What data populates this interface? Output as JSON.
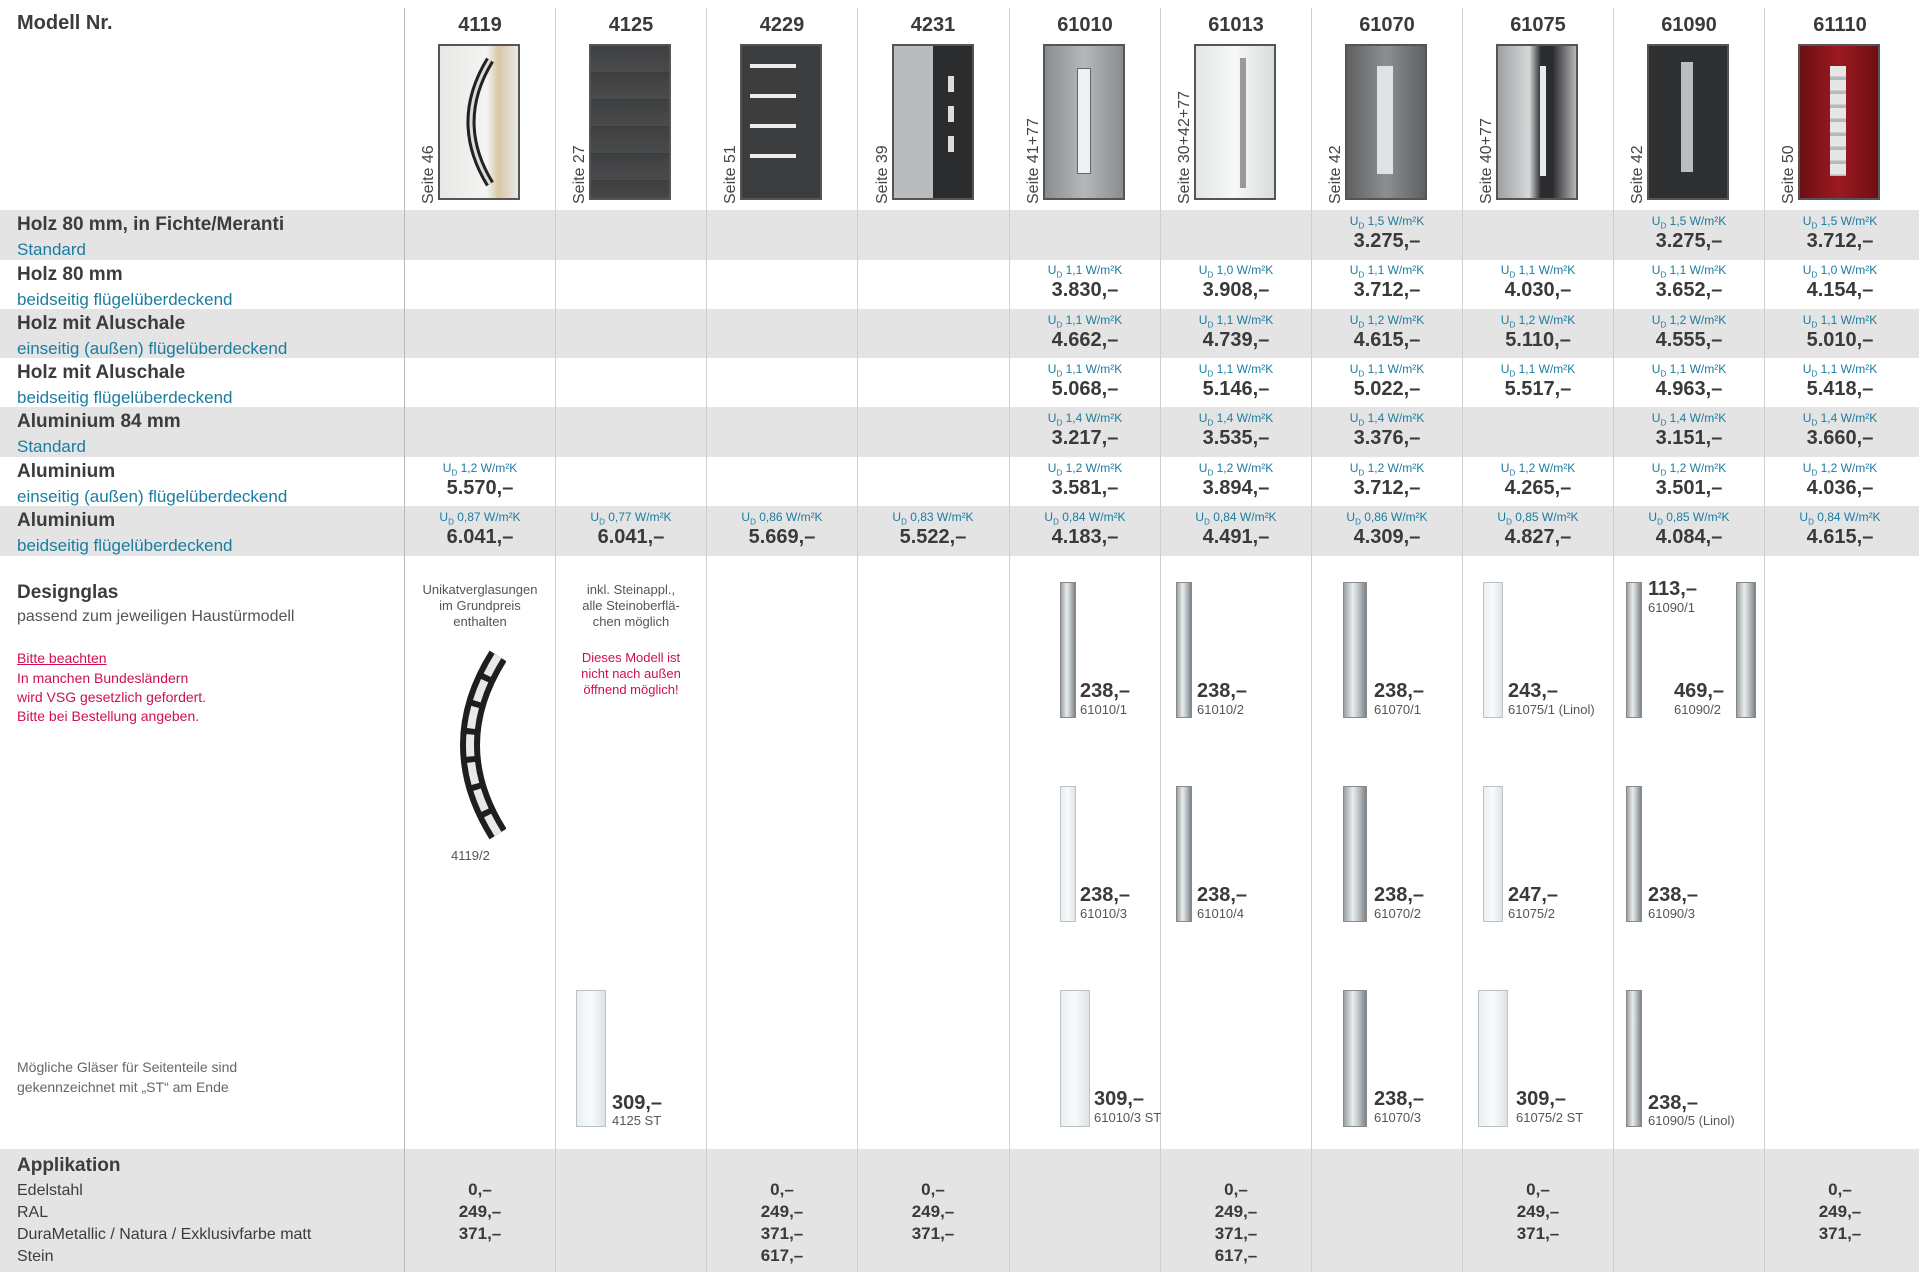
{
  "header": {
    "label": "Modell Nr."
  },
  "models": [
    {
      "nr": "4119",
      "seite": "Seite 46"
    },
    {
      "nr": "4125",
      "seite": "Seite 27"
    },
    {
      "nr": "4229",
      "seite": "Seite 51"
    },
    {
      "nr": "4231",
      "seite": "Seite 39"
    },
    {
      "nr": "61010",
      "seite": "Seite 41+77"
    },
    {
      "nr": "61013",
      "seite": "Seite 30+42+77"
    },
    {
      "nr": "61070",
      "seite": "Seite 42"
    },
    {
      "nr": "61075",
      "seite": "Seite 40+77"
    },
    {
      "nr": "61090",
      "seite": "Seite 42"
    },
    {
      "nr": "61110",
      "seite": "Seite 50"
    }
  ],
  "price_rows": [
    {
      "title": "Holz 80 mm, in Fichte/Meranti",
      "sub": "Standard",
      "cells": [
        null,
        null,
        null,
        null,
        null,
        null,
        {
          "ud": "1,5 W/m²K",
          "price": "3.275,–"
        },
        null,
        {
          "ud": "1,5 W/m²K",
          "price": "3.275,–"
        },
        {
          "ud": "1,5 W/m²K",
          "price": "3.712,–"
        }
      ]
    },
    {
      "title": "Holz 80 mm",
      "sub": "beidseitig flügelüberdeckend",
      "cells": [
        null,
        null,
        null,
        null,
        {
          "ud": "1,1 W/m²K",
          "price": "3.830,–"
        },
        {
          "ud": "1,0 W/m²K",
          "price": "3.908,–"
        },
        {
          "ud": "1,1 W/m²K",
          "price": "3.712,–"
        },
        {
          "ud": "1,1 W/m²K",
          "price": "4.030,–"
        },
        {
          "ud": "1,1 W/m²K",
          "price": "3.652,–"
        },
        {
          "ud": "1,0 W/m²K",
          "price": "4.154,–"
        }
      ]
    },
    {
      "title": "Holz mit Aluschale",
      "sub": "einseitig (außen) flügelüberdeckend",
      "cells": [
        null,
        null,
        null,
        null,
        {
          "ud": "1,1 W/m²K",
          "price": "4.662,–"
        },
        {
          "ud": "1,1 W/m²K",
          "price": "4.739,–"
        },
        {
          "ud": "1,2 W/m²K",
          "price": "4.615,–"
        },
        {
          "ud": "1,2 W/m²K",
          "price": "5.110,–"
        },
        {
          "ud": "1,2 W/m²K",
          "price": "4.555,–"
        },
        {
          "ud": "1,1 W/m²K",
          "price": "5.010,–"
        }
      ]
    },
    {
      "title": "Holz mit Aluschale",
      "sub": "beidseitig flügelüberdeckend",
      "cells": [
        null,
        null,
        null,
        null,
        {
          "ud": "1,1 W/m²K",
          "price": "5.068,–"
        },
        {
          "ud": "1,1 W/m²K",
          "price": "5.146,–"
        },
        {
          "ud": "1,1 W/m²K",
          "price": "5.022,–"
        },
        {
          "ud": "1,1 W/m²K",
          "price": "5.517,–"
        },
        {
          "ud": "1,1 W/m²K",
          "price": "4.963,–"
        },
        {
          "ud": "1,1 W/m²K",
          "price": "5.418,–"
        }
      ]
    },
    {
      "title": "Aluminium 84 mm",
      "sub": "Standard",
      "cells": [
        null,
        null,
        null,
        null,
        {
          "ud": "1,4 W/m²K",
          "price": "3.217,–"
        },
        {
          "ud": "1,4 W/m²K",
          "price": "3.535,–"
        },
        {
          "ud": "1,4 W/m²K",
          "price": "3.376,–"
        },
        null,
        {
          "ud": "1,4 W/m²K",
          "price": "3.151,–"
        },
        {
          "ud": "1,4 W/m²K",
          "price": "3.660,–"
        }
      ]
    },
    {
      "title": "Aluminium",
      "sub": "einseitig (außen) flügelüberdeckend",
      "cells": [
        {
          "ud": "1,2 W/m²K",
          "price": "5.570,–"
        },
        null,
        null,
        null,
        {
          "ud": "1,2 W/m²K",
          "price": "3.581,–"
        },
        {
          "ud": "1,2 W/m²K",
          "price": "3.894,–"
        },
        {
          "ud": "1,2 W/m²K",
          "price": "3.712,–"
        },
        {
          "ud": "1,2 W/m²K",
          "price": "4.265,–"
        },
        {
          "ud": "1,2 W/m²K",
          "price": "3.501,–"
        },
        {
          "ud": "1,2 W/m²K",
          "price": "4.036,–"
        }
      ]
    },
    {
      "title": "Aluminium",
      "sub": "beidseitig flügelüberdeckend",
      "cells": [
        {
          "ud": "0,87 W/m²K",
          "price": "6.041,–"
        },
        {
          "ud": "0,77 W/m²K",
          "price": "6.041,–"
        },
        {
          "ud": "0,86 W/m²K",
          "price": "5.669,–"
        },
        {
          "ud": "0,83 W/m²K",
          "price": "5.522,–"
        },
        {
          "ud": "0,84 W/m²K",
          "price": "4.183,–"
        },
        {
          "ud": "0,84 W/m²K",
          "price": "4.491,–"
        },
        {
          "ud": "0,86 W/m²K",
          "price": "4.309,–"
        },
        {
          "ud": "0,85 W/m²K",
          "price": "4.827,–"
        },
        {
          "ud": "0,85 W/m²K",
          "price": "4.084,–"
        },
        {
          "ud": "0,84 W/m²K",
          "price": "4.615,–"
        }
      ]
    }
  ],
  "designglas": {
    "title": "Designglas",
    "sub": "passend zum jeweiligen Haustürmodell",
    "hint_link": "Bitte beachten",
    "hint_lines": [
      "In manchen Bundesländern",
      "wird VSG gesetzlich gefordert.",
      "Bitte bei Bestellung angeben."
    ],
    "st_note": [
      "Mögliche Gläser für Seitenteile sind",
      "gekennzeichnet mit „ST“ am Ende"
    ],
    "note_4119": [
      "Unikatverglasungen",
      "im Grundpreis",
      "enthalten"
    ],
    "code_4119": "4119/2",
    "note_4125": [
      "inkl. Steinappl.,",
      "alle Steinoberflä-",
      "chen möglich"
    ],
    "warn_4125": [
      "Dieses Modell ist",
      "nicht nach außen",
      "öffnend möglich!"
    ],
    "glasses": [
      {
        "price": "309,–",
        "code": "4125 ST"
      },
      {
        "price": "238,–",
        "code": "61010/1"
      },
      {
        "price": "238,–",
        "code": "61010/2"
      },
      {
        "price": "238,–",
        "code": "61010/3"
      },
      {
        "price": "238,–",
        "code": "61010/4"
      },
      {
        "price": "309,–",
        "code": "61010/3 ST"
      },
      {
        "price": "238,–",
        "code": "61070/1"
      },
      {
        "price": "238,–",
        "code": "61070/2"
      },
      {
        "price": "238,–",
        "code": "61070/3"
      },
      {
        "price": "243,–",
        "code": "61075/1 (Linol)"
      },
      {
        "price": "247,–",
        "code": "61075/2"
      },
      {
        "price": "309,–",
        "code": "61075/2 ST"
      },
      {
        "price": "113,–",
        "code": "61090/1"
      },
      {
        "price": "469,–",
        "code": "61090/2"
      },
      {
        "price": "238,–",
        "code": "61090/3"
      },
      {
        "price": "238,–",
        "code": "61090/5 (Linol)"
      }
    ]
  },
  "applikation": {
    "title": "Applikation",
    "items": [
      "Edelstahl",
      "RAL",
      "DuraMetallic / Natura / Exklusivfarbe matt",
      "Stein"
    ],
    "columns": [
      [
        "0,–",
        "249,–",
        "371,–",
        ""
      ],
      [
        "",
        "",
        "",
        ""
      ],
      [
        "0,–",
        "249,–",
        "371,–",
        "617,–"
      ],
      [
        "0,–",
        "249,–",
        "371,–",
        ""
      ],
      [
        "",
        "",
        "",
        ""
      ],
      [
        "0,–",
        "249,–",
        "371,–",
        "617,–"
      ],
      [
        "",
        "",
        "",
        ""
      ],
      [
        "0,–",
        "249,–",
        "371,–",
        ""
      ],
      [
        "",
        "",
        "",
        ""
      ],
      [
        "0,–",
        "249,–",
        "371,–",
        ""
      ]
    ]
  }
}
